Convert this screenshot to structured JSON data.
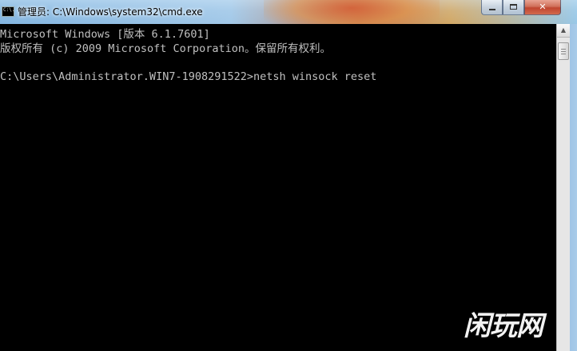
{
  "window": {
    "title": "管理员: C:\\Windows\\system32\\cmd.exe",
    "icon_label": "C:\\.",
    "controls": {
      "minimize": "minimize-icon",
      "maximize": "maximize-icon",
      "close": "✕"
    }
  },
  "console": {
    "lines": [
      "Microsoft Windows [版本 6.1.7601]",
      "版权所有 (c) 2009 Microsoft Corporation。保留所有权利。",
      "C:\\Users\\Administrator.WIN7-1908291522>netsh winsock reset"
    ],
    "background": "#000000",
    "foreground": "#c0c0c0"
  },
  "scrollbar": {
    "up_arrow": "▲"
  },
  "watermark": {
    "text": "闲玩网"
  }
}
